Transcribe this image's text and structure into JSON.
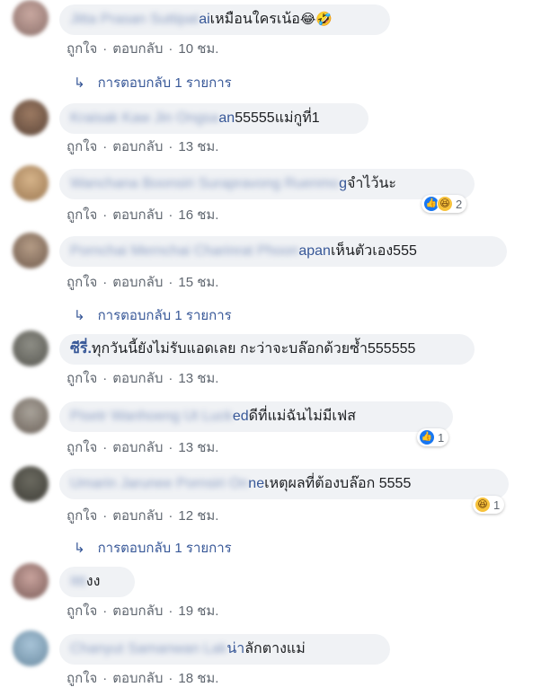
{
  "comments": [
    {
      "name": "Jitta Prasan Suttipat",
      "tail": "ai",
      "text": " เหมือนใครเน้อ",
      "emojis": "😂🤣",
      "like": "ถูกใจ",
      "reply": "ตอบกลับ",
      "time": "10 ชม.",
      "replies": "การตอบกลับ 1 รายการ"
    },
    {
      "name": "Kraisak Kaw Jin Ongsa",
      "tail": "an",
      "text": "55555แม่กูที่1",
      "like": "ถูกใจ",
      "reply": "ตอบกลับ",
      "time": "13 ชม."
    },
    {
      "name": "Wanchana Boonsiri Surapravong Ruenmo",
      "tail": "g",
      "text": "จำไว้นะ",
      "like": "ถูกใจ",
      "reply": "ตอบกลับ",
      "time": "16 ชม.",
      "reaction_count": "2"
    },
    {
      "name": "Pornchai Mernchai Charinrat Phoon",
      "tail": "apan",
      "text": " เห็นตัวเอง555",
      "like": "ถูกใจ",
      "reply": "ตอบกลับ",
      "time": "15 ชม.",
      "replies": "การตอบกลับ 1 รายการ"
    },
    {
      "name": "ซีรี่.",
      "text": " ทุกวันนี้ยังไม่รับแอดเลย กะว่าจะบล๊อกด้วยซ้ำ555555",
      "like": "ถูกใจ",
      "reply": "ตอบกลับ",
      "time": "13 ชม."
    },
    {
      "name": "Pisetr Wanhoeng Ut Luck",
      "tail": "ed",
      "text": " ดีที่แม่ฉันไม่มีเฟส",
      "like": "ถูกใจ",
      "reply": "ตอบกลับ",
      "time": "13 ชม.",
      "reaction_count": "1"
    },
    {
      "name": "Umarin Jarunee Pornsiri On",
      "tail": "ne",
      "text": " เหตุผลที่ต้องบล๊อก 5555",
      "like": "ถูกใจ",
      "reply": "ตอบกลับ",
      "time": "12 ชม.",
      "reaction_count": "1",
      "replies": "การตอบกลับ 1 รายการ"
    },
    {
      "name": "Ittt",
      "text": "งง",
      "like": "ถูกใจ",
      "reply": "ตอบกลับ",
      "time": "19 ชม."
    },
    {
      "name": "Chanyut Samanwan Lak",
      "tail": "น่า",
      "text": " ลักตางแม่",
      "like": "ถูกใจ",
      "reply": "ตอบกลับ",
      "time": "18 ชม."
    }
  ],
  "colors": {
    "bubble": "#f0f2f5",
    "link": "#385898",
    "meta": "#606770",
    "like_blue": "#1877f2",
    "haha_yellow": "#f7c23b"
  },
  "icons": {
    "reply_arrow": "reply-arrow-icon",
    "like": "like-reaction-icon",
    "haha": "haha-reaction-icon"
  }
}
